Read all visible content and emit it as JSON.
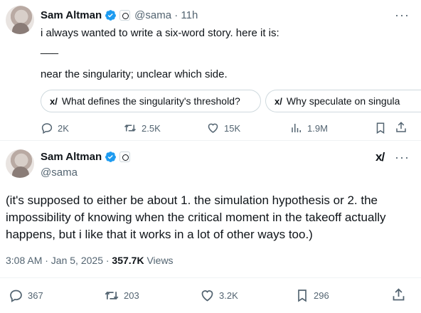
{
  "tweet1": {
    "author_name": "Sam Altman",
    "handle_time": "@sama · 11h",
    "line1": "i always wanted to write a six-word story. here it is:",
    "line2": "___",
    "line3": "near the singularity; unclear which side.",
    "grok_chips": [
      "What defines the singularity's threshold?",
      "Why speculate on singula"
    ],
    "stats": {
      "replies": "2K",
      "retweets": "2.5K",
      "likes": "15K",
      "views": "1.9M"
    }
  },
  "tweet2": {
    "author_name": "Sam Altman",
    "handle": "@sama",
    "body_line1": "(it's supposed to either be about 1. the simulation hypothesis or 2. the",
    "body_line2": "impossibility of knowing when the critical moment in the takeoff actually",
    "body_line3": "happens, but i like that it works in a lot of other ways too.)",
    "timestamp": "3:08 AM · Jan 5, 2025 · ",
    "views_count": "357.7K",
    "views_label": " Views",
    "stats": {
      "replies": "367",
      "retweets": "203",
      "likes": "3.2K",
      "bookmarks": "296"
    }
  },
  "colors": {
    "verified": "#1d9bf0",
    "text": "#0f1419",
    "muted": "#536471"
  }
}
